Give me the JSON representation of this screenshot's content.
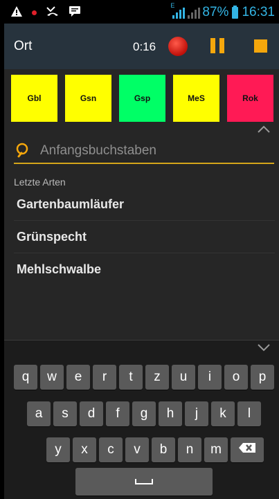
{
  "status_bar": {
    "battery": "87%",
    "time": "16:31",
    "network_label": "E"
  },
  "action_bar": {
    "title": "Ort",
    "timer": "0:16"
  },
  "tiles": [
    {
      "label": "Gbl",
      "color": "#ffff00"
    },
    {
      "label": "Gsn",
      "color": "#ffff00"
    },
    {
      "label": "Gsp",
      "color": "#00ff66"
    },
    {
      "label": "MeS",
      "color": "#ffff00"
    },
    {
      "label": "Rok",
      "color": "#ff1a55"
    }
  ],
  "search": {
    "placeholder": "Anfangsbuchstaben",
    "value": ""
  },
  "recent": {
    "label": "Letzte Arten",
    "items": [
      "Gartenbaumläufer",
      "Grünspecht",
      "Mehlschwalbe"
    ]
  },
  "keyboard": {
    "row1": [
      "q",
      "w",
      "e",
      "r",
      "t",
      "z",
      "u",
      "i",
      "o",
      "p"
    ],
    "row2": [
      "a",
      "s",
      "d",
      "f",
      "g",
      "h",
      "j",
      "k",
      "l"
    ],
    "row3": [
      "y",
      "x",
      "c",
      "v",
      "b",
      "n",
      "m"
    ]
  },
  "colors": {
    "accent": "#f5a70c",
    "actionbar": "#27333d",
    "status_icons": "#33b5e5"
  }
}
